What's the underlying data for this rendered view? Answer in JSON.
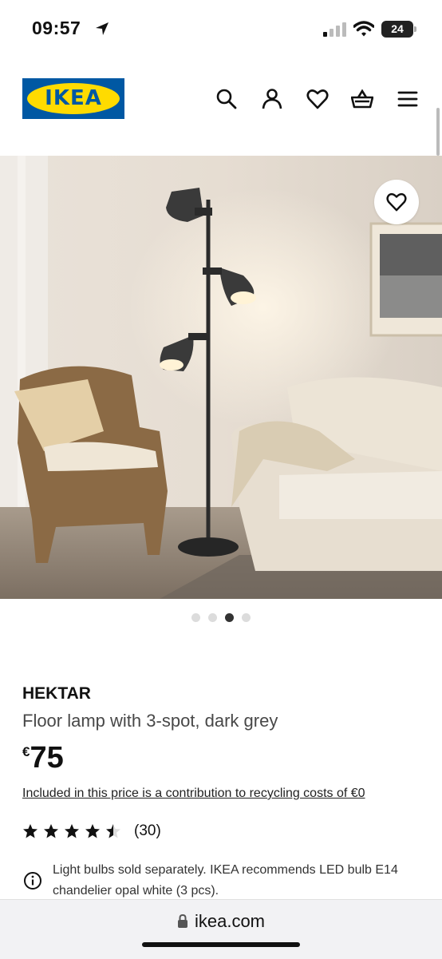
{
  "status": {
    "time": "09:57",
    "battery": "24"
  },
  "header": {
    "logo_text": "IKEA",
    "icons": [
      "search-icon",
      "profile-icon",
      "heart-icon",
      "basket-icon",
      "menu-icon"
    ]
  },
  "gallery": {
    "image_count": 4,
    "active_index": 2
  },
  "product": {
    "name": "HEKTAR",
    "description": "Floor lamp with 3-spot, dark grey",
    "currency": "€",
    "price": "75",
    "recycle_note": "Included in this price is a contribution to recycling costs of €0",
    "rating": 4.5,
    "review_count": "(30)",
    "info": "Light bulbs sold separately. IKEA recommends LED bulb E14 chandelier opal white (3 pcs)."
  },
  "browser": {
    "url": "ikea.com"
  },
  "colors": {
    "brand_blue": "#0058a3",
    "brand_yellow": "#ffdb00"
  }
}
